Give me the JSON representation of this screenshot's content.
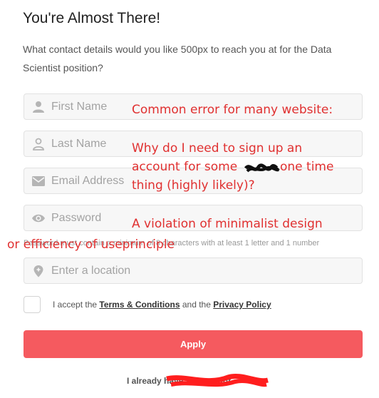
{
  "header": {
    "title": "You're Almost There!",
    "subtitle": "What contact details would you like 500px to reach you at for the Data Scientist position?"
  },
  "form": {
    "first_name_placeholder": "First Name",
    "last_name_placeholder": "Last Name",
    "email_placeholder": "Email Address",
    "password_placeholder": "Password",
    "password_hint": "Password must contain a minimum of 8 characters with at least 1 letter and 1 number",
    "location_placeholder": "Enter a location",
    "accept_prefix": "I accept the",
    "terms_link": "Terms & Conditions",
    "accept_middle": "and the",
    "privacy_link": "Privacy Policy",
    "apply_label": "Apply",
    "signin_text": "I already have an account"
  },
  "annotations": {
    "line1": "Common error for many website:",
    "line2": "Why do I need to sign up an",
    "line3": "account for some",
    "line3b": "one time",
    "line4": "thing (highly likely)?",
    "line5": "A violation of minimalist design",
    "line6": "or efficiency of useprinciple"
  },
  "colors": {
    "accent": "#f55a5f",
    "annotation": "#e03030",
    "icon": "#b5b5b5"
  }
}
